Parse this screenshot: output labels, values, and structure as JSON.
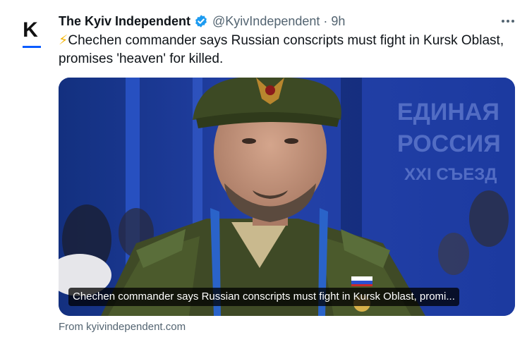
{
  "author": {
    "name": "The Kyiv Independent",
    "handle": "@KyivIndependent",
    "separator": "·",
    "time": "9h",
    "avatar_letter": "K",
    "verified_color": "#1d9bf0"
  },
  "tweet": {
    "emoji": "⚡",
    "text": "Chechen commander says Russian conscripts must fight in Kursk Oblast, promises 'heaven' for killed."
  },
  "card": {
    "caption": "Chechen commander says Russian conscripts must fight in Kursk Oblast, promi...",
    "backdrop_text": [
      "ЕДИНАЯ",
      "РОССИЯ",
      "XXI СЪЕЗД"
    ],
    "source": "From kyivindependent.com"
  },
  "icons": {
    "more": "more-icon",
    "verified": "verified-badge-icon"
  }
}
